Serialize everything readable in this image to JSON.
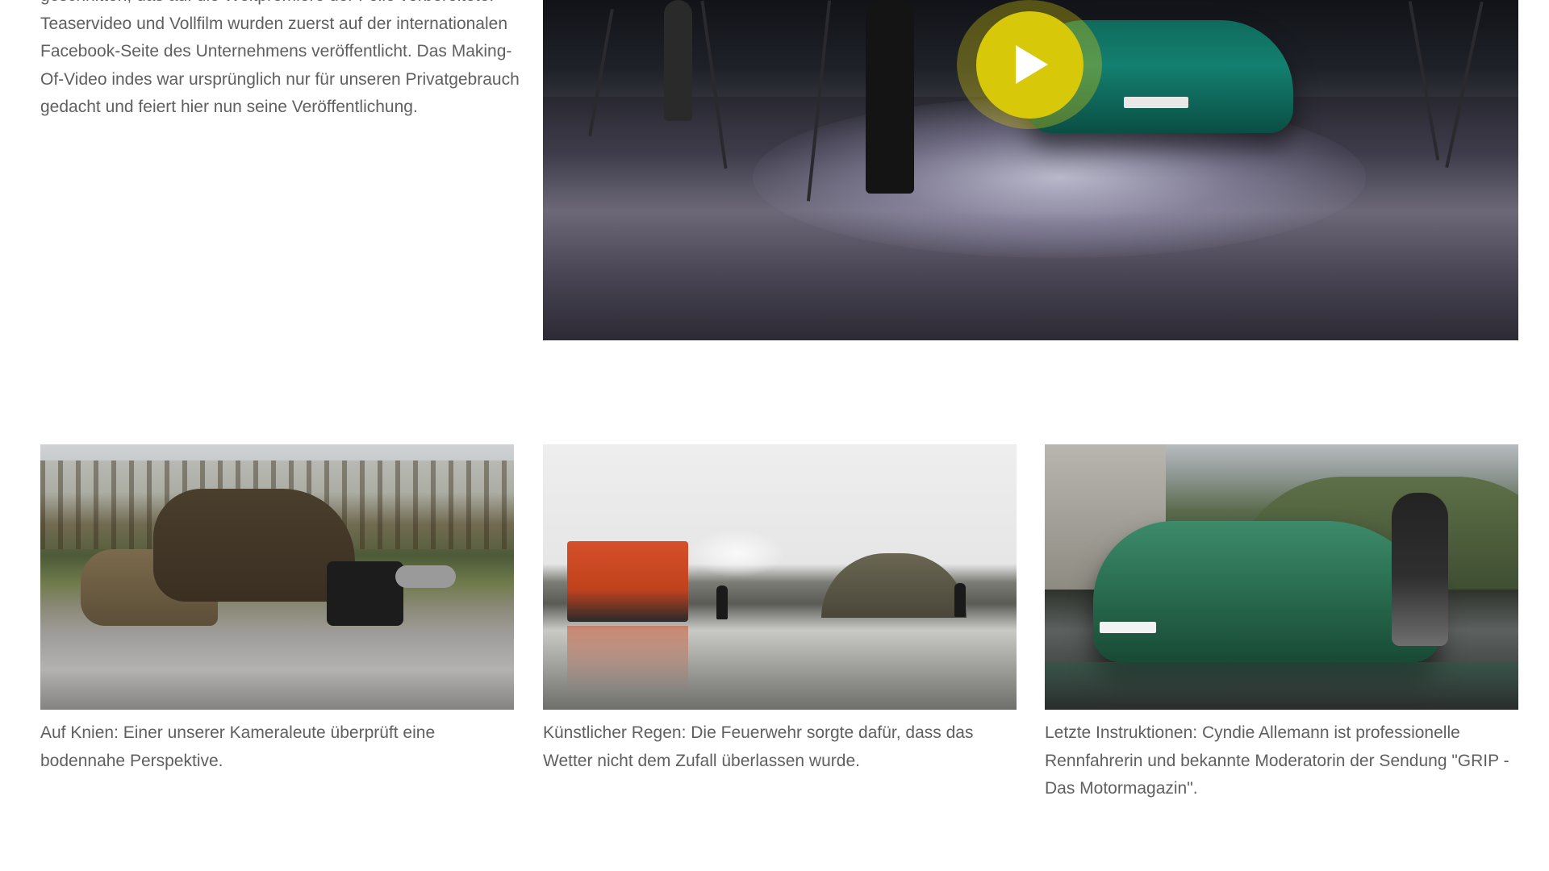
{
  "intro": {
    "paragraph": "geschnitten, das auf die Weltpremiere der Folie vorbereitete. Teaservideo und Vollfilm wurden zuerst auf der internationalen Facebook-Seite des Unternehmens veröffentlicht. Das Making-Of-Video indes war ursprünglich nur für unseren Privatgebrauch gedacht und feiert hier nun seine Veröffentlichung."
  },
  "video": {
    "play_icon": "play-icon",
    "accent_color": "#d7c90a"
  },
  "gallery": [
    {
      "caption": "Auf Knien: Einer unserer Kameraleute überprüft eine bodennahe Perspektive."
    },
    {
      "caption": "Künstlicher Regen: Die Feuerwehr sorgte dafür, dass das Wetter nicht dem Zufall überlassen wurde."
    },
    {
      "caption": "Letzte Instruktionen: Cyndie Allemann ist professionelle Rennfahrerin und bekannte Moderatorin der Sendung \"GRIP - Das Motormagazin\"."
    }
  ]
}
